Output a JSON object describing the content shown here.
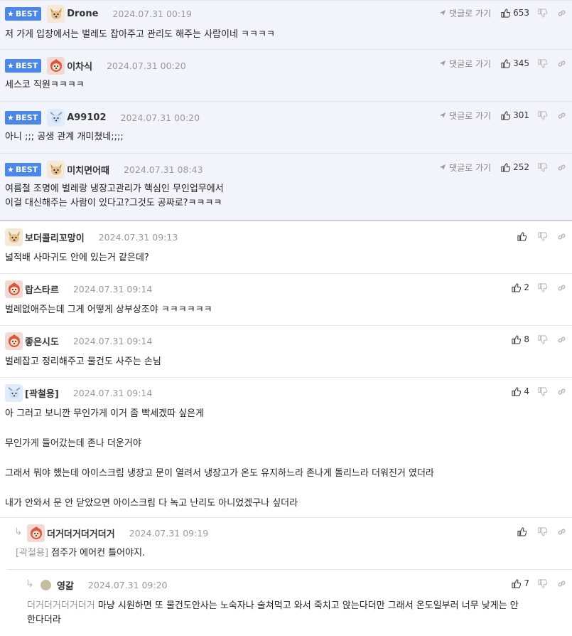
{
  "labels": {
    "best": "BEST",
    "reply_to": "댓글로 가기"
  },
  "colors": {
    "accent": "#4a87e8",
    "best_bg": "#f1f4fb"
  },
  "comments": [
    {
      "best": true,
      "avatar": "dog-icon",
      "nick": "Drone",
      "date": "2024.07.31 00:19",
      "likes": "653",
      "body": "저 가게 입장에서는 벌레도 잡아주고 관리도 해주는 사람이네 ㅋㅋㅋㅋ"
    },
    {
      "best": true,
      "avatar": "firedog-icon",
      "nick": "이차식",
      "date": "2024.07.31 00:20",
      "likes": "345",
      "body": "세스코 직원ㅋㅋㅋㅋ"
    },
    {
      "best": true,
      "avatar": "icedog-icon",
      "nick": "A99102",
      "date": "2024.07.31 00:20",
      "likes": "301",
      "body": "아니 ;;; 공생 관계 개미쳤네;;;;"
    },
    {
      "best": true,
      "avatar": "dog-icon",
      "nick": "미치면어때",
      "date": "2024.07.31 08:43",
      "likes": "252",
      "body": "여름철 조명에 벌레랑 냉장고관리가 핵심인 무인업무에서\n이걸 대신해주는 사람이 있다고?그것도 공짜로?ㅋㅋㅋㅋ"
    },
    {
      "best": false,
      "avatar": "dog-icon",
      "nick": "보더콜리꼬망이",
      "date": "2024.07.31 09:13",
      "likes": "",
      "body": "넓적배 사마귀도 안에 있는거 같은데?"
    },
    {
      "best": false,
      "avatar": "firedog-icon",
      "nick": "랍스타르",
      "date": "2024.07.31 09:14",
      "likes": "2",
      "body": "벌레없애주는데 그게 어떻게 상부상조야 ㅋㅋㅋㅋㅋㅋ"
    },
    {
      "best": false,
      "avatar": "firedog-icon",
      "nick": "좋은시도",
      "date": "2024.07.31 09:14",
      "likes": "8",
      "body": "벌레잡고 정리해주고 물건도 사주는 손님"
    },
    {
      "best": false,
      "avatar": "icedog-icon",
      "nick": "[곽철용]",
      "date": "2024.07.31 09:14",
      "likes": "4",
      "body": "아 그러고 보니깐 무인가게 이거 좀 빡세겠따 싶은게\n\n무인가게 들어갔는데 존나 더운거야\n\n그래서 뭐야 했는데 아이스크림 냉장고 문이 열려서 냉장고가 온도 유지하느라 존나게 돌리느라 더워진거 였더라\n\n내가 안와서 문 안 닫았으면 아이스크림 다 녹고 난리도 아니었겠구나 싶더라"
    },
    {
      "best": false,
      "avatar": "firedog-icon",
      "nick": "더거더거더거더거",
      "date": "2024.07.31 09:19",
      "likes": "",
      "mention": "[곽철용]",
      "body": "점주가 에어컨 틀어야지."
    },
    {
      "best": false,
      "avatar": "dot-icon",
      "nick": "영갊",
      "date": "2024.07.31 09:20",
      "likes": "7",
      "mention": "더거더거더거더거",
      "body": "마냥 시원하면 또 물건도안사는 노숙자나 술쳐먹고 와서 죽치고 앉는다더만 그래서 온도일부러 너무 낮게는 안\n한다더라"
    }
  ]
}
